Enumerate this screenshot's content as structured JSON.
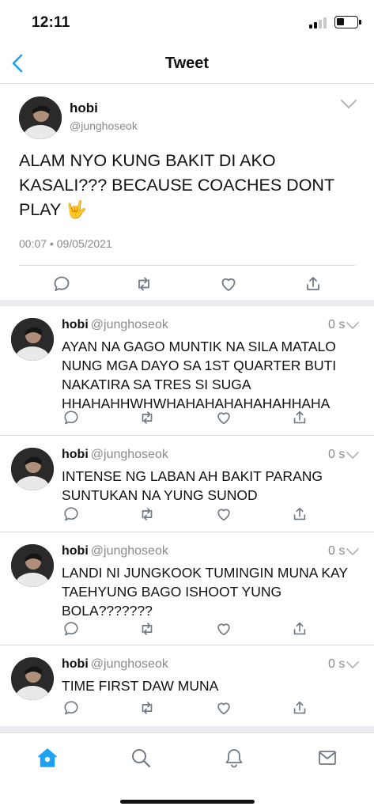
{
  "status_bar": {
    "time": "12:11"
  },
  "header": {
    "title": "Tweet"
  },
  "main_tweet": {
    "name": "hobi",
    "handle": "@junghoseok",
    "text": "ALAM NYO KUNG BAKIT DI AKO KASALI??? BECAUSE COACHES DONT PLAY 🤟",
    "date": "00:07 • 09/05/2021"
  },
  "replies": [
    {
      "name": "hobi",
      "handle": "@junghoseok",
      "time": "0 s",
      "text": "AYAN NA GAGO MUNTIK NA SILA MATALO NUNG MGA DAYO SA 1ST QUARTER BUTI NAKATIRA SA TRES SI SUGA HHAHAHHWHWHAHAHAHAHAHAHHAHA"
    },
    {
      "name": "hobi",
      "handle": "@junghoseok",
      "time": "0 s",
      "text": "INTENSE NG LABAN AH BAKIT PARANG SUNTUKAN NA YUNG SUNOD"
    },
    {
      "name": "hobi",
      "handle": "@junghoseok",
      "time": "0 s",
      "text": "LANDI NI JUNGKOOK TUMINGIN MUNA KAY TAEHYUNG BAGO ISHOOT YUNG BOLA???????"
    },
    {
      "name": "hobi",
      "handle": "@junghoseok",
      "time": "0 s",
      "text": "TIME FIRST DAW MUNA"
    }
  ],
  "icons": {
    "back": "chevron-left-icon",
    "menu": "chevron-down-icon",
    "reply": "comment-icon",
    "retweet": "retweet-icon",
    "like": "heart-icon",
    "share": "share-icon",
    "tabs": [
      "home-icon",
      "search-icon",
      "bell-icon",
      "mail-icon"
    ]
  },
  "colors": {
    "accent": "#1da1f2",
    "text": "#111111",
    "muted": "#8a8a8a",
    "divider": "#dcdcdc",
    "band": "#ececf0"
  }
}
